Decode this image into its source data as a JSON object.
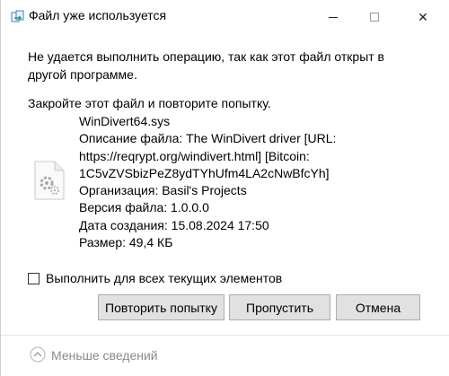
{
  "window": {
    "title": "Файл уже используется",
    "close_glyph": "✕"
  },
  "message": {
    "main": "Не удается выполнить операцию, так как этот файл открыт в другой программе.",
    "instruction": "Закройте этот файл и повторите попытку."
  },
  "file": {
    "lines": [
      "WinDivert64.sys",
      "Описание файла: The WinDivert driver [URL:",
      "https://reqrypt.org/windivert.html] [Bitcoin:",
      "1C5vZVSbizPeZ8ydTYhUfm4LA2cNwBfcYh]",
      "Организация: Basil's Projects",
      "Версия файла: 1.0.0.0",
      "Дата создания: 15.08.2024 17:50",
      "Размер: 49,4 КБ"
    ]
  },
  "checkbox": {
    "label": "Выполнить для всех текущих элементов",
    "checked": false
  },
  "buttons": {
    "retry": "Повторить попытку",
    "skip": "Пропустить",
    "cancel": "Отмена"
  },
  "footer": {
    "less_details": "Меньше сведений"
  },
  "icons": {
    "app": "file-copy-icon",
    "file": "settings-file-icon",
    "collapse": "chevron-up-circle-icon"
  },
  "colors": {
    "button_bg": "#e1e1e1",
    "button_border": "#adadad",
    "muted_text": "#8a8a8a"
  }
}
